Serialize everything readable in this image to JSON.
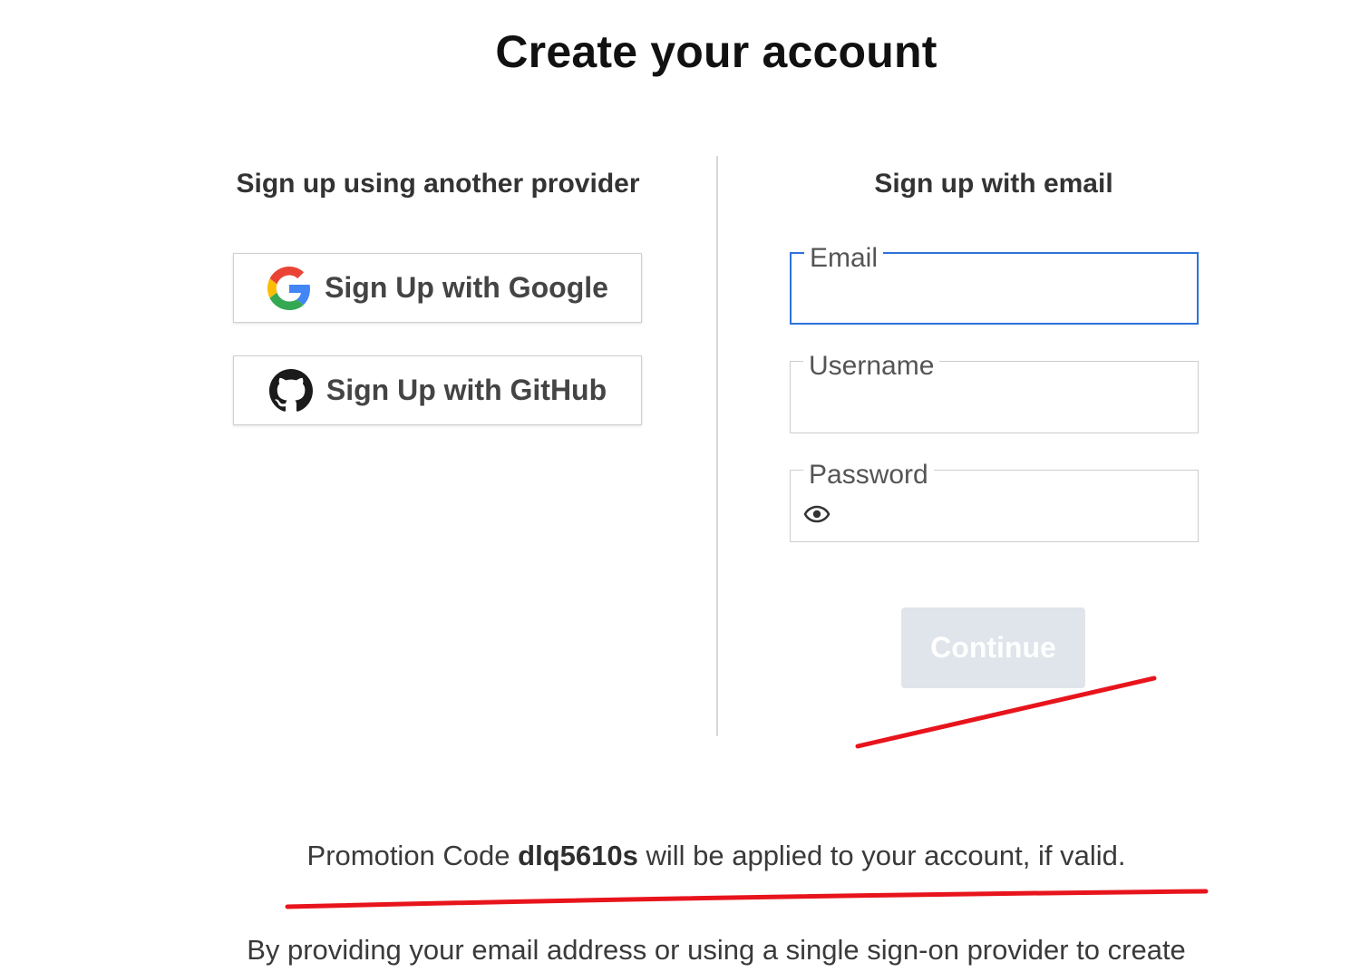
{
  "page": {
    "title": "Create your account"
  },
  "left_section": {
    "heading": "Sign up using another provider",
    "providers": [
      {
        "label": "Sign Up with Google",
        "icon": "google-icon"
      },
      {
        "label": "Sign Up with GitHub",
        "icon": "github-icon"
      }
    ]
  },
  "right_section": {
    "heading": "Sign up with email",
    "fields": {
      "email": {
        "label": "Email",
        "value": ""
      },
      "username": {
        "label": "Username",
        "value": ""
      },
      "password": {
        "label": "Password",
        "value": "",
        "icon": "eye-icon"
      }
    },
    "continue_label": "Continue"
  },
  "promo": {
    "prefix": "Promotion Code ",
    "code": "dlq5610s",
    "suffix": " will be applied to your account, if valid."
  },
  "disclaimer": "By providing your email address or using a single sign-on provider to create",
  "colors": {
    "focus_border": "#2d72d9",
    "continue_disabled_bg": "#dfe5ea",
    "annotation_red": "#e8141c"
  }
}
